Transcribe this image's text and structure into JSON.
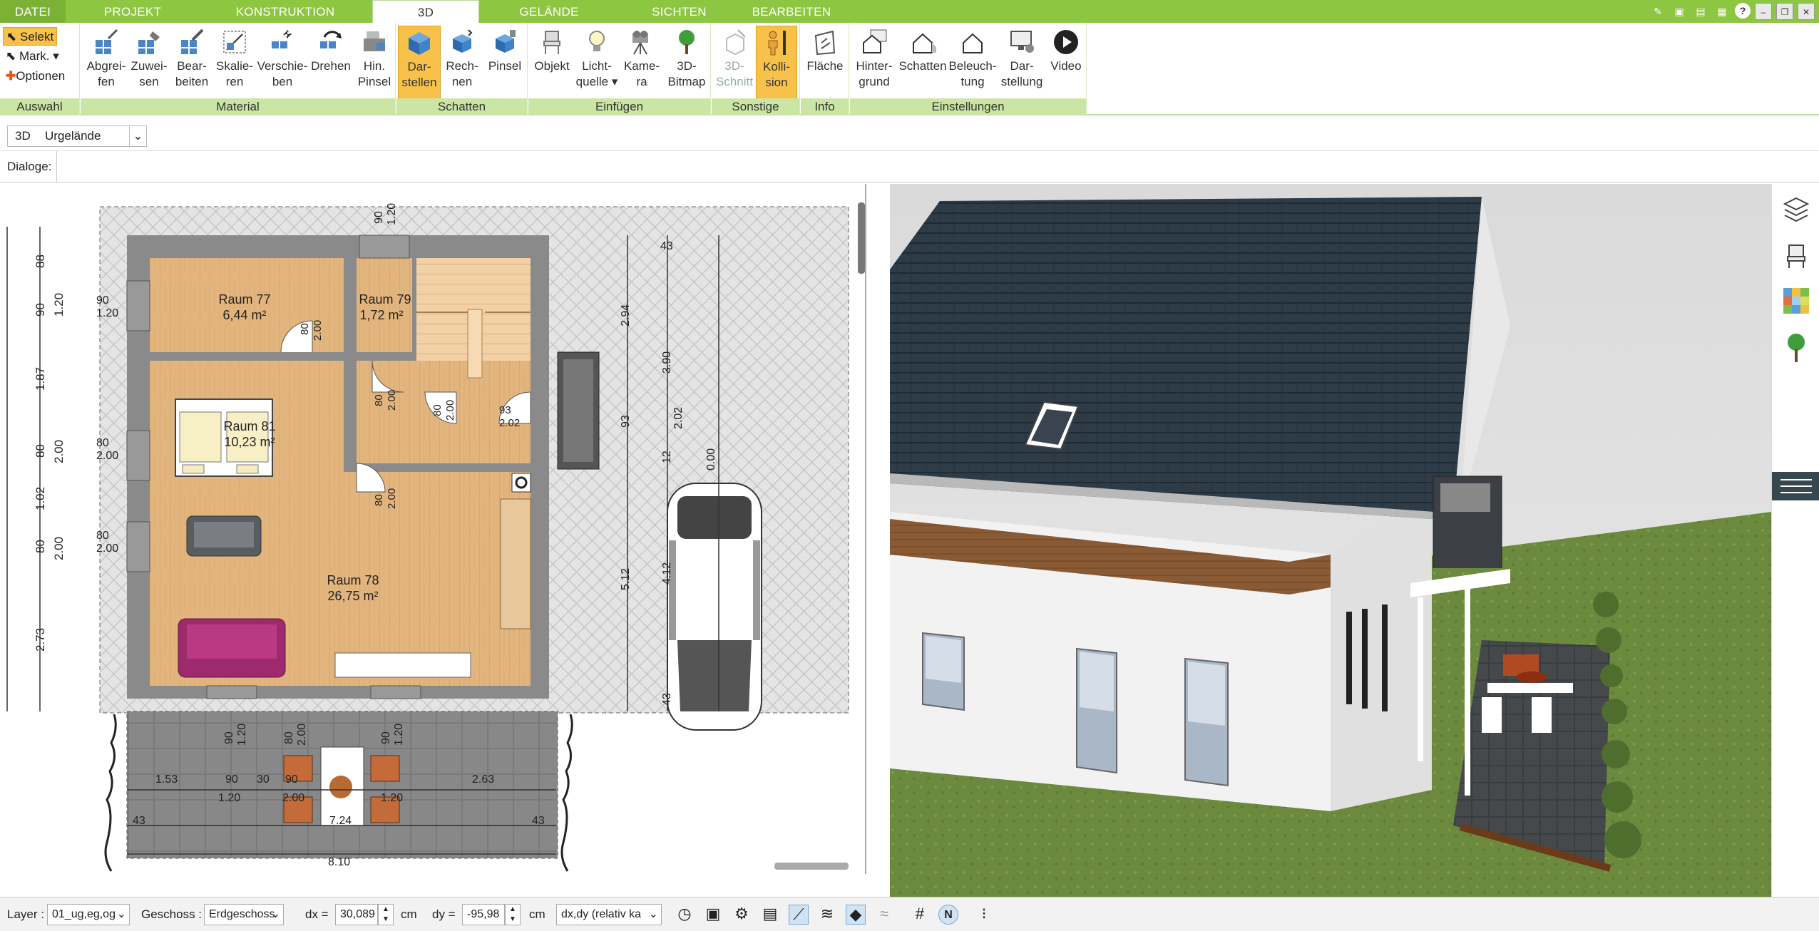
{
  "tabs": [
    {
      "label": "DATEI"
    },
    {
      "label": "PROJEKT"
    },
    {
      "label": "KONSTRUKTION"
    },
    {
      "label": "3D"
    },
    {
      "label": "GELÄNDE"
    },
    {
      "label": "SICHTEN"
    },
    {
      "label": "BEARBEITEN"
    }
  ],
  "ribbon": {
    "auswahl": {
      "select": "Selekt",
      "mark": "Mark.",
      "optionen": "Optionen",
      "group": "Auswahl"
    },
    "material": {
      "group": "Material",
      "buttons": [
        {
          "l1": "Abgrei-",
          "l2": "fen"
        },
        {
          "l1": "Zuwei-",
          "l2": "sen"
        },
        {
          "l1": "Bear-",
          "l2": "beiten"
        },
        {
          "l1": "Skalie-",
          "l2": "ren"
        },
        {
          "l1": "Verschie-",
          "l2": "ben"
        },
        {
          "l1": "Drehen",
          "l2": ""
        },
        {
          "l1": "Hin.",
          "l2": "Pinsel"
        }
      ]
    },
    "schatten": {
      "group": "Schatten",
      "buttons": [
        {
          "l1": "Dar-",
          "l2": "stellen"
        },
        {
          "l1": "Rech-",
          "l2": "nen"
        },
        {
          "l1": "Pinsel",
          "l2": ""
        }
      ]
    },
    "einfuegen": {
      "group": "Einfügen",
      "buttons": [
        {
          "l1": "Objekt",
          "l2": ""
        },
        {
          "l1": "Licht-",
          "l2": "quelle"
        },
        {
          "l1": "Kame-",
          "l2": "ra"
        },
        {
          "l1": "3D-",
          "l2": "Bitmap"
        }
      ]
    },
    "sonstige": {
      "group": "Sonstige",
      "buttons": [
        {
          "l1": "3D-",
          "l2": "Schnitt"
        },
        {
          "l1": "Kolli-",
          "l2": "sion"
        }
      ]
    },
    "info": {
      "group": "Info",
      "buttons": [
        {
          "l1": "Fläche",
          "l2": ""
        }
      ]
    },
    "einstellungen": {
      "group": "Einstellungen",
      "buttons": [
        {
          "l1": "Hinter-",
          "l2": "grund"
        },
        {
          "l1": "Schatten",
          "l2": ""
        },
        {
          "l1": "Beleuch-",
          "l2": "tung"
        },
        {
          "l1": "Dar-",
          "l2": "stellung"
        },
        {
          "l1": "Video",
          "l2": ""
        }
      ]
    }
  },
  "viewbar": {
    "mode": "3D",
    "terrain": "Urgelände"
  },
  "dialogs": {
    "label": "Dialoge:"
  },
  "plan": {
    "rooms": [
      {
        "name": "Raum 77",
        "area": "6,44 m²"
      },
      {
        "name": "Raum 79",
        "area": "1,72 m²"
      },
      {
        "name": "Raum 81",
        "area": "10,23 m²"
      },
      {
        "name": "Raum 78",
        "area": "26,75 m²"
      }
    ],
    "dims_left": [
      "88",
      "1.20",
      "90",
      "1.87",
      "80",
      "2.00",
      "1.02",
      "80",
      "2.00",
      "2.73"
    ],
    "dims_wall": [
      "90",
      "1.20",
      "80",
      "2.00",
      "80",
      "2.00"
    ],
    "dims_top": [
      "90",
      "1.20"
    ],
    "door_labels": [
      "80",
      "2.00",
      "80",
      "2.00",
      "80",
      "2.00",
      "93",
      "2.02",
      "80",
      "2.00"
    ],
    "drive_dims": [
      "43",
      "2.94",
      "3.90",
      "93",
      "2.02",
      "12",
      "0.00",
      "5.12",
      "4.12",
      "43"
    ],
    "terrace_dims": [
      "1.53",
      "90",
      "30",
      "90",
      "2.63",
      "1.20",
      "2.00",
      "1.20",
      "90",
      "1.20",
      "80",
      "2.00",
      "90",
      "1.20",
      "7.24",
      "43",
      "43",
      "8.10"
    ]
  },
  "status": {
    "layer_label": "Layer :",
    "layer_value": "01_ug,eg,og",
    "geschoss_label": "Geschoss :",
    "geschoss_value": "Erdgeschoss",
    "dx_label": "dx =",
    "dx_value": "30,089",
    "dx_unit": "cm",
    "dy_label": "dy =",
    "dy_value": "-95,98",
    "dy_unit": "cm",
    "mode_value": "dx,dy (relativ ka"
  },
  "colors": {
    "accent": "#8dc640",
    "group_bar": "#cbe6a4",
    "selected": "#f8c24a",
    "roof": "#2c3e4a"
  }
}
